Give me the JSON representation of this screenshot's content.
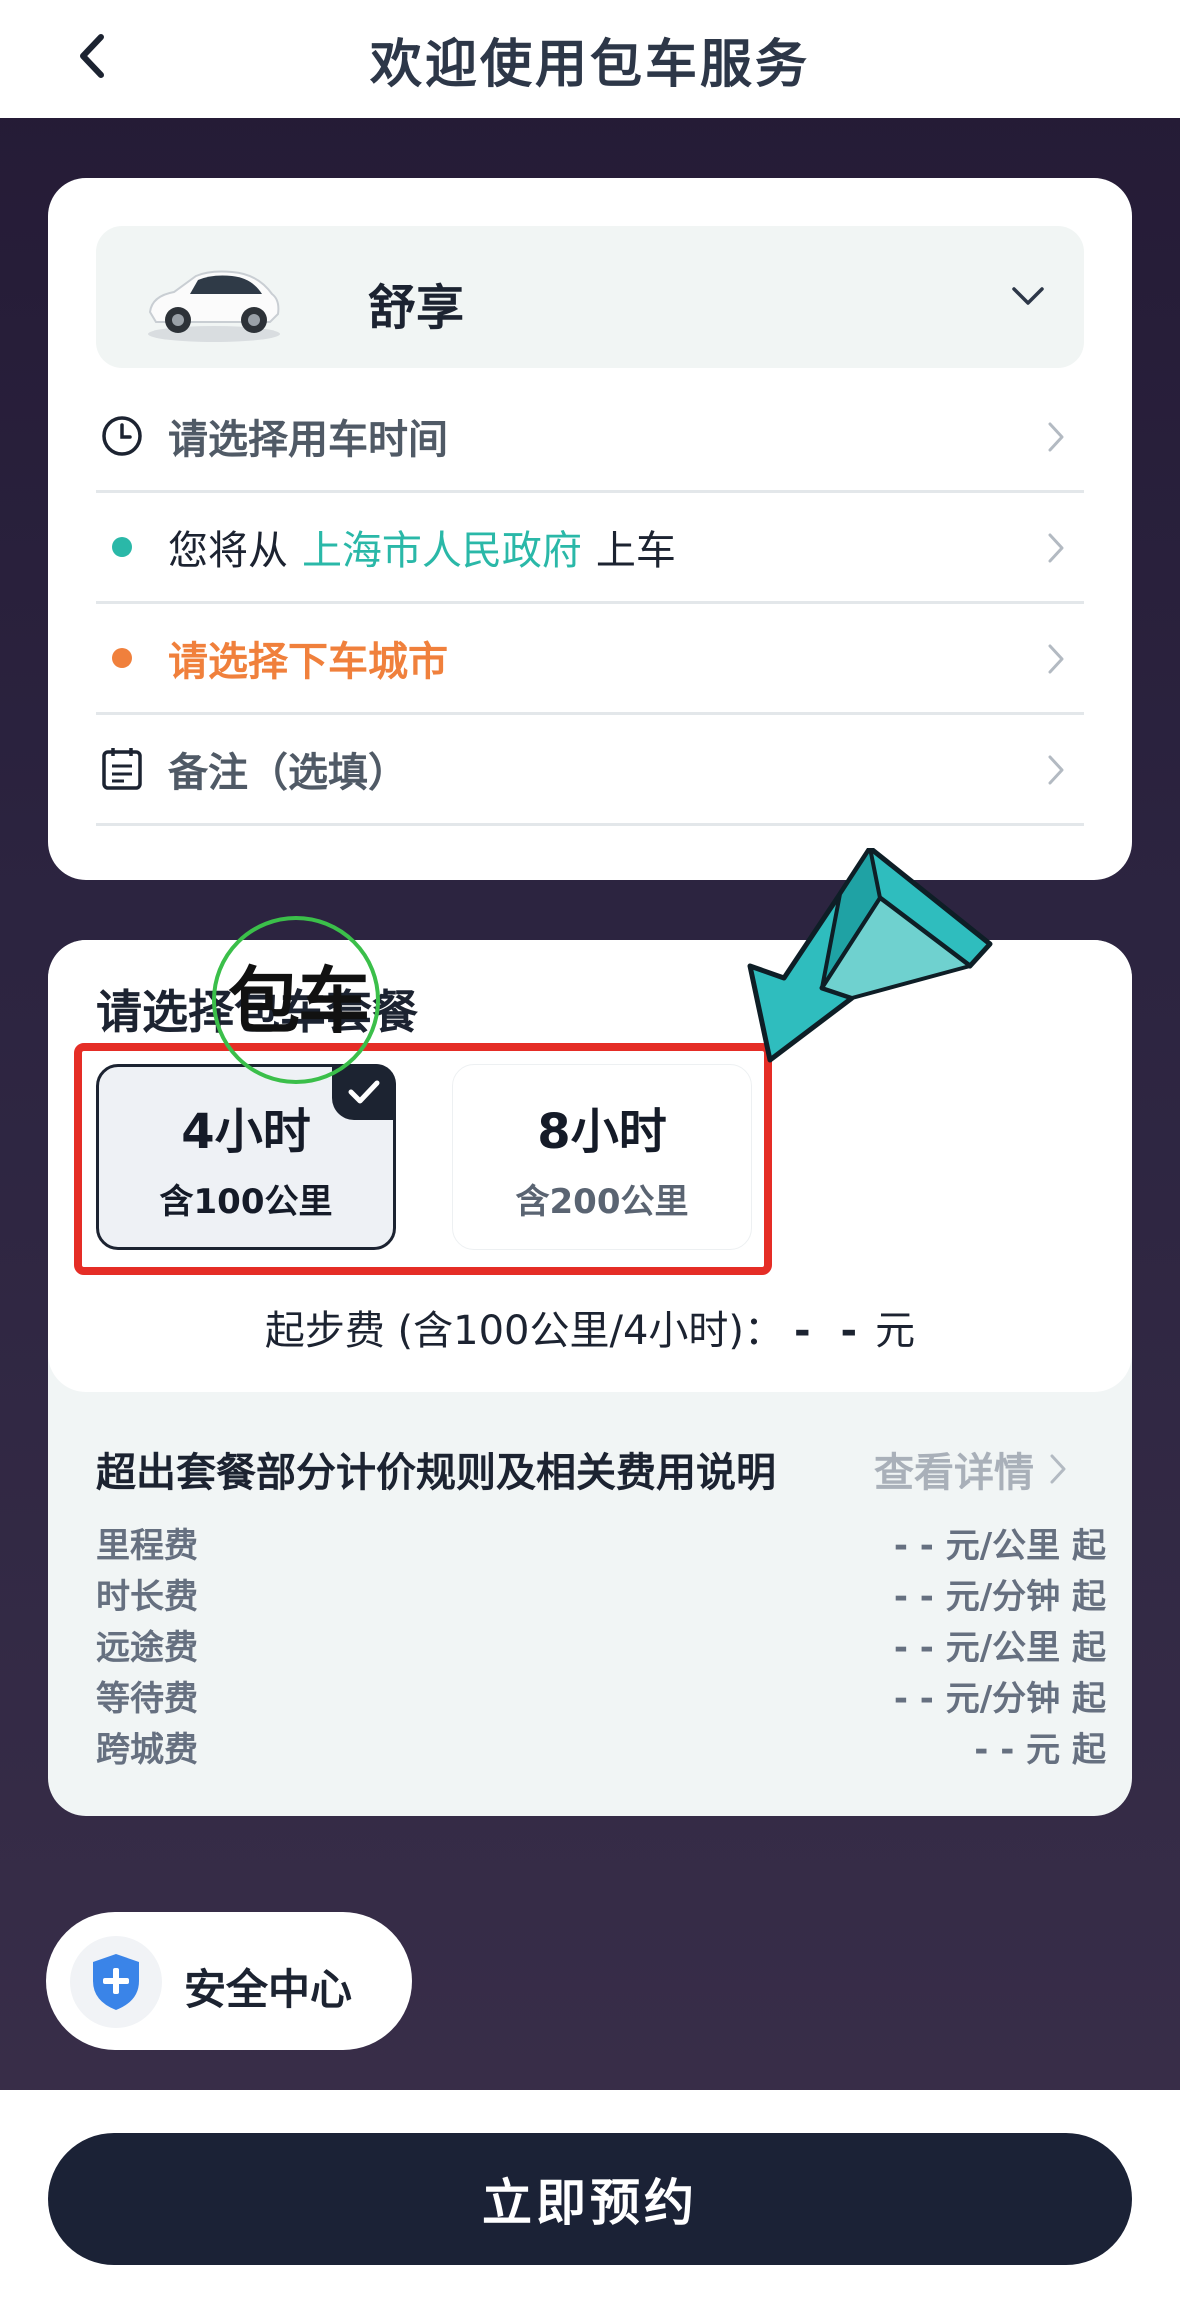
{
  "header": {
    "title": "欢迎使用包车服务"
  },
  "car": {
    "name": "舒享"
  },
  "rows": {
    "time": "请选择用车时间",
    "pickup_prefix": "您将从",
    "pickup_place": "上海市人民政府",
    "pickup_suffix": "上车",
    "dropoff": "请选择下车城市",
    "note": "备注（选填）"
  },
  "packages": {
    "title": "请选择包车套餐",
    "items": [
      {
        "hours": "4小时",
        "km": "含100公里",
        "selected": true
      },
      {
        "hours": "8小时",
        "km": "含200公里",
        "selected": false
      }
    ]
  },
  "fee": {
    "label": "起步费 (含100公里/4小时)：",
    "value": "- -",
    "unit": "元"
  },
  "rules": {
    "title": "超出套餐部分计价规则及相关费用说明",
    "details": "查看详情",
    "items": [
      {
        "label": "里程费",
        "value": "- - 元/公里 起"
      },
      {
        "label": "时长费",
        "value": "- - 元/分钟 起"
      },
      {
        "label": "远途费",
        "value": "- - 元/公里 起"
      },
      {
        "label": "等待费",
        "value": "- - 元/分钟 起"
      },
      {
        "label": "跨城费",
        "value": "- - 元 起"
      }
    ]
  },
  "safety": {
    "label": "安全中心"
  },
  "footer": {
    "book_label": "立即预约"
  },
  "annotation": {
    "text": "包车"
  },
  "colors": {
    "accent_teal": "#2ab8a8",
    "accent_orange": "#f0803c",
    "primary_dark": "#1b2236",
    "highlight_red": "#e52d26"
  }
}
